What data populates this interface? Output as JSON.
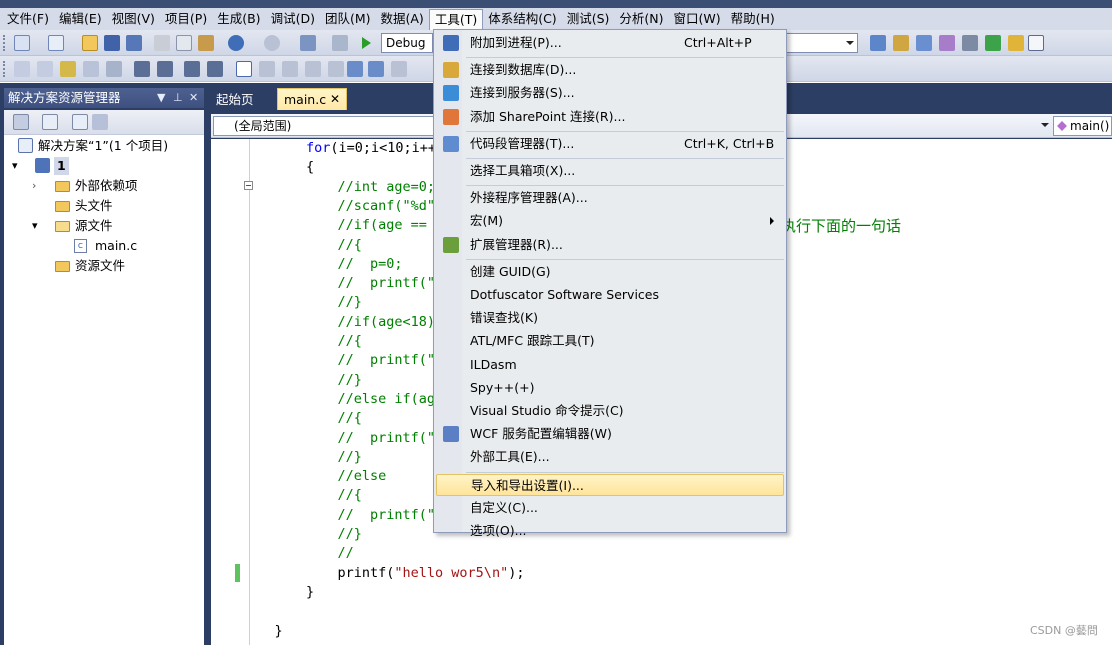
{
  "menubar": {
    "items": [
      "文件(F)",
      "编辑(E)",
      "视图(V)",
      "项目(P)",
      "生成(B)",
      "调试(D)",
      "团队(M)",
      "数据(A)",
      "工具(T)",
      "体系结构(C)",
      "测试(S)",
      "分析(N)",
      "窗口(W)",
      "帮助(H)"
    ]
  },
  "toolbar": {
    "config_value": "Debug"
  },
  "solution_explorer": {
    "title": "解决方案资源管理器",
    "solution_label": "解决方案“1”(1 个项目)",
    "project_label": "1",
    "external_deps": "外部依赖项",
    "headers": "头文件",
    "sources": "源文件",
    "main_file": "main.c",
    "resources": "资源文件"
  },
  "editor": {
    "tab_start": "起始页",
    "tab_active": "main.c",
    "scope": "(全局范围)",
    "function": "main()",
    "comment_tail": "执行下面的一句话",
    "code": [
      {
        "indent": 2,
        "parts": [
          [
            "kw",
            "for"
          ],
          [
            "",
            "(i=0;i<10;i++)"
          ]
        ]
      },
      {
        "indent": 2,
        "parts": [
          [
            "",
            "{"
          ]
        ]
      },
      {
        "indent": 3,
        "parts": [
          [
            "cm",
            "//int age=0;int"
          ]
        ]
      },
      {
        "indent": 3,
        "parts": [
          [
            "cm",
            "//scanf(\"%d\",&a"
          ]
        ]
      },
      {
        "indent": 3,
        "parts": [
          [
            "cm",
            "//if(age == 0)/"
          ]
        ]
      },
      {
        "indent": 3,
        "parts": [
          [
            "cm",
            "//{"
          ]
        ]
      },
      {
        "indent": 3,
        "parts": [
          [
            "cm",
            "//  p=0;"
          ]
        ]
      },
      {
        "indent": 3,
        "parts": [
          [
            "cm",
            "//  printf(\"%d\""
          ]
        ]
      },
      {
        "indent": 3,
        "parts": [
          [
            "cm",
            "//}"
          ]
        ]
      },
      {
        "indent": 3,
        "parts": [
          [
            "cm",
            "//if(age<18)"
          ]
        ]
      },
      {
        "indent": 3,
        "parts": [
          [
            "cm",
            "//{"
          ]
        ]
      },
      {
        "indent": 3,
        "parts": [
          [
            "cm",
            "//  printf(\"未成"
          ]
        ]
      },
      {
        "indent": 3,
        "parts": [
          [
            "cm",
            "//}"
          ]
        ]
      },
      {
        "indent": 3,
        "parts": [
          [
            "cm",
            "//else if(age>="
          ]
        ]
      },
      {
        "indent": 3,
        "parts": [
          [
            "cm",
            "//{"
          ]
        ]
      },
      {
        "indent": 3,
        "parts": [
          [
            "cm",
            "//  printf(\"大龄"
          ]
        ]
      },
      {
        "indent": 3,
        "parts": [
          [
            "cm",
            "//}"
          ]
        ]
      },
      {
        "indent": 3,
        "parts": [
          [
            "cm",
            "//else"
          ]
        ]
      },
      {
        "indent": 3,
        "parts": [
          [
            "cm",
            "//{"
          ]
        ]
      },
      {
        "indent": 3,
        "parts": [
          [
            "cm",
            "//  printf(\"age"
          ]
        ]
      },
      {
        "indent": 3,
        "parts": [
          [
            "cm",
            "//}"
          ]
        ]
      },
      {
        "indent": 3,
        "parts": [
          [
            "cm",
            "//"
          ]
        ]
      },
      {
        "indent": 3,
        "parts": [
          [
            "",
            "printf("
          ],
          [
            "st",
            "\"hello wor5\\n\""
          ],
          [
            "",
            ");"
          ]
        ]
      },
      {
        "indent": 2,
        "parts": [
          [
            "",
            "}"
          ]
        ]
      },
      {
        "indent": 0,
        "parts": [
          [
            "",
            ""
          ]
        ]
      },
      {
        "indent": 1,
        "parts": [
          [
            "",
            "}"
          ]
        ]
      }
    ]
  },
  "tools_menu": {
    "items": [
      {
        "label": "附加到进程(P)...",
        "shortcut": "Ctrl+Alt+P",
        "icon": "attach-process-icon",
        "color": "#3f6db8"
      },
      {
        "sep": true
      },
      {
        "label": "连接到数据库(D)...",
        "shortcut": "",
        "icon": "connect-database-icon",
        "color": "#d8a93a"
      },
      {
        "label": "连接到服务器(S)...",
        "shortcut": "",
        "icon": "connect-server-icon",
        "color": "#3a8dd6"
      },
      {
        "label": "添加 SharePoint 连接(R)...",
        "shortcut": "",
        "icon": "sharepoint-icon",
        "color": "#e0763a"
      },
      {
        "sep": true
      },
      {
        "label": "代码段管理器(T)...",
        "shortcut": "Ctrl+K, Ctrl+B",
        "icon": "snippet-manager-icon",
        "color": "#5f8bd0"
      },
      {
        "sep": true
      },
      {
        "label": "选择工具箱项(X)...",
        "shortcut": "",
        "icon": "",
        "color": ""
      },
      {
        "sep": true
      },
      {
        "label": "外接程序管理器(A)...",
        "shortcut": "",
        "icon": "",
        "color": ""
      },
      {
        "label": "宏(M)",
        "shortcut": "",
        "icon": "",
        "color": "",
        "submenu": true
      },
      {
        "label": "扩展管理器(R)...",
        "shortcut": "",
        "icon": "extension-manager-icon",
        "color": "#6a9f3c"
      },
      {
        "sep": true
      },
      {
        "label": "创建 GUID(G)",
        "shortcut": "",
        "icon": "",
        "color": ""
      },
      {
        "label": "Dotfuscator Software Services",
        "shortcut": "",
        "icon": "",
        "color": ""
      },
      {
        "label": "错误查找(K)",
        "shortcut": "",
        "icon": "",
        "color": ""
      },
      {
        "label": "ATL/MFC 跟踪工具(T)",
        "shortcut": "",
        "icon": "",
        "color": ""
      },
      {
        "label": "ILDasm",
        "shortcut": "",
        "icon": "",
        "color": ""
      },
      {
        "label": "Spy++(+)",
        "shortcut": "",
        "icon": "",
        "color": ""
      },
      {
        "label": "Visual Studio 命令提示(C)",
        "shortcut": "",
        "icon": "",
        "color": ""
      },
      {
        "label": "WCF 服务配置编辑器(W)",
        "shortcut": "",
        "icon": "wcf-editor-icon",
        "color": "#5a7fc4"
      },
      {
        "label": "外部工具(E)...",
        "shortcut": "",
        "icon": "",
        "color": ""
      },
      {
        "sep": true
      },
      {
        "label": "导入和导出设置(I)...",
        "shortcut": "",
        "icon": "",
        "color": "",
        "highlight": true
      },
      {
        "label": "自定义(C)...",
        "shortcut": "",
        "icon": "",
        "color": ""
      },
      {
        "label": "选项(O)...",
        "shortcut": "",
        "icon": "",
        "color": ""
      }
    ]
  },
  "watermark": "CSDN @藝問"
}
